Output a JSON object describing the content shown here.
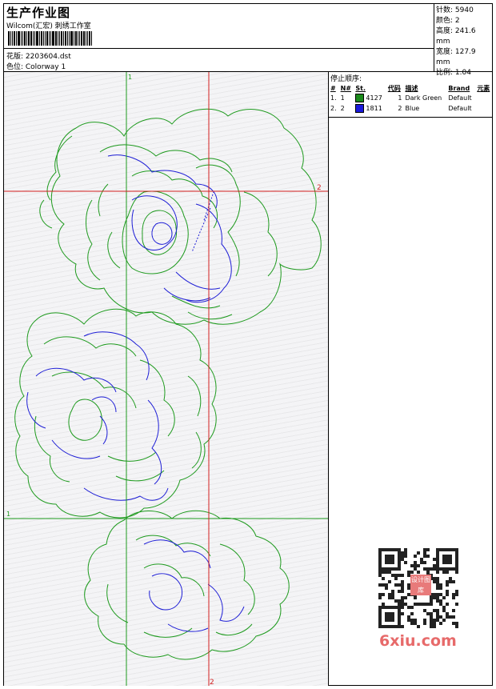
{
  "header": {
    "title": "生产作业图",
    "studio": "Wilcom(汇宏) 刺绣工作室",
    "design_label": "花版: 2203604.dst",
    "colorway_label": "色位:  Colorway 1",
    "stats": [
      "针数:  5940",
      "颜色:  2",
      "高度:  241.6 mm",
      "宽度:  127.9 mm",
      "比例:  1.04"
    ]
  },
  "stop_sequence": {
    "title": "停止顺序:",
    "columns": [
      "#",
      "N#",
      "St.",
      "代码",
      "描述",
      "Brand",
      "元素"
    ],
    "rows": [
      {
        "idx": "1.",
        "n": "1",
        "stitches": "4127",
        "code": "1",
        "desc": "Dark Green",
        "brand": "Default",
        "color": "#1a8a1a"
      },
      {
        "idx": "2.",
        "n": "2",
        "stitches": "1811",
        "code": "2",
        "desc": "Blue",
        "brand": "Default",
        "color": "#1a1adc"
      }
    ]
  },
  "canvas": {
    "guide_labels": {
      "green_top": "1",
      "green_left": "1",
      "red_right": "2",
      "red_bottom": "2"
    },
    "colors": {
      "green": "#1e9a1e",
      "blue": "#1e1ed6",
      "red": "#d21e1e"
    }
  },
  "watermark": {
    "text": "6xiu.com",
    "badge": "设计图库"
  }
}
